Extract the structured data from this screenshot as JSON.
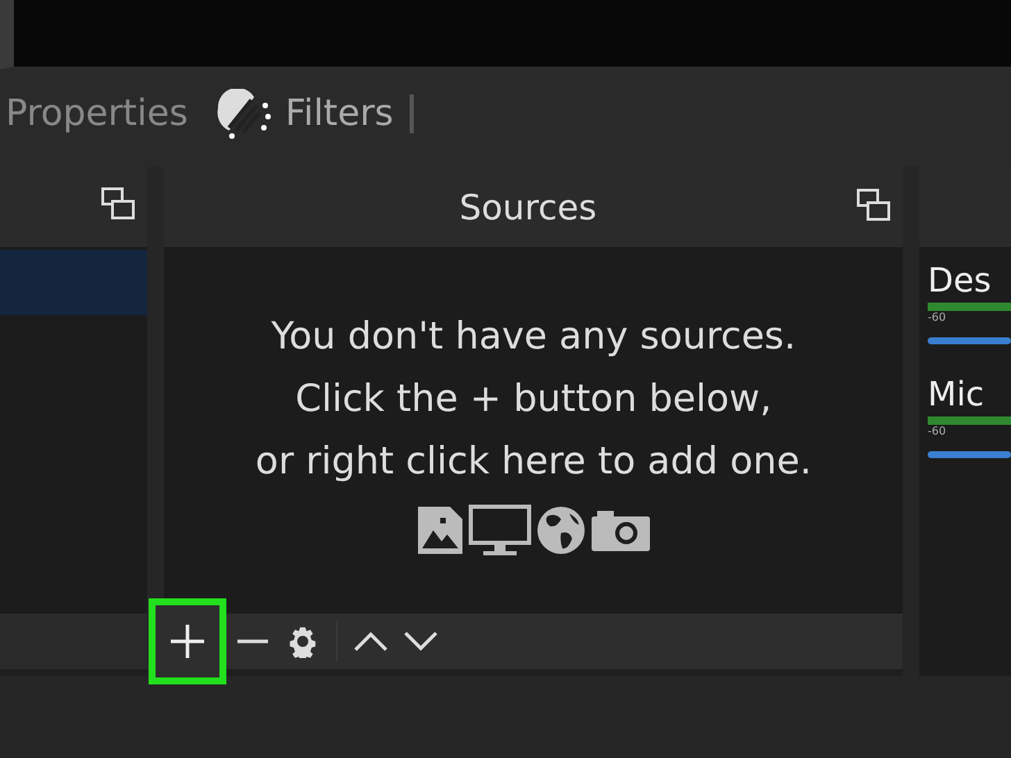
{
  "tabs": [
    {
      "label": "Properties",
      "kind": "plain"
    },
    {
      "label": "Filters",
      "kind": "filter"
    }
  ],
  "scenes": {
    "rows": [
      {
        "selected": true
      }
    ]
  },
  "sources": {
    "title": "Sources",
    "message": [
      "You don't have any sources.",
      "Click the + button below,",
      "or right click here to add one."
    ],
    "toolbar": [
      {
        "kind": "add",
        "highlighted": true
      },
      {
        "kind": "remove",
        "highlighted": false
      },
      {
        "kind": "settings",
        "highlighted": false
      },
      {
        "kind": "up",
        "highlighted": false
      },
      {
        "kind": "down",
        "highlighted": false
      }
    ]
  },
  "mixer": {
    "channels": [
      {
        "name": "Des",
        "tick": "-60",
        "level": 1
      },
      {
        "name": "Mic",
        "tick": "-60",
        "level": 1
      }
    ]
  }
}
